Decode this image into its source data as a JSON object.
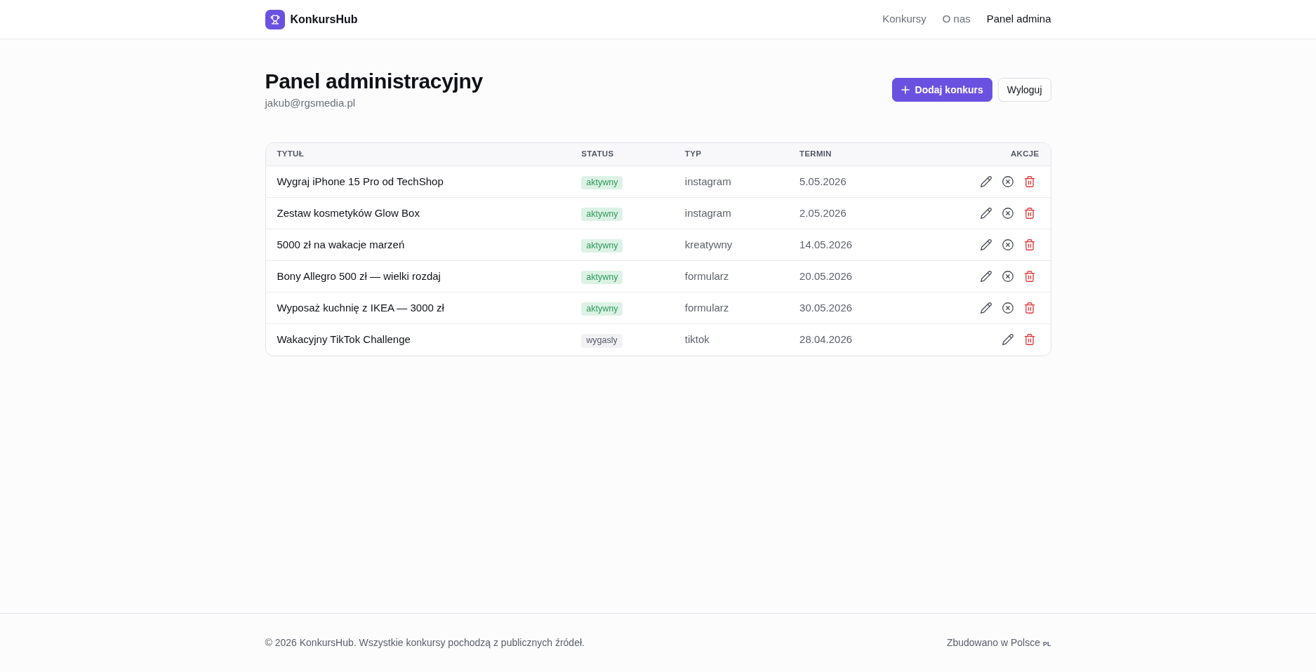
{
  "navbar": {
    "brand": "KonkursHub",
    "links": [
      {
        "label": "Konkursy",
        "selected": false
      },
      {
        "label": "O nas",
        "selected": false
      },
      {
        "label": "Panel admina",
        "selected": true
      }
    ]
  },
  "header": {
    "title": "Panel administracyjny",
    "email": "jakub@rgsmedia.pl",
    "buttons": [
      {
        "label": "Dodaj konkurs",
        "kind": "primary"
      },
      {
        "label": "Wyloguj",
        "kind": "outline"
      }
    ]
  },
  "table": {
    "columns": [
      "TYTUŁ",
      "STATUS",
      "TYP",
      "TERMIN",
      "AKCJE"
    ],
    "rows": [
      {
        "title": "Wygraj iPhone 15 Pro od TechShop",
        "status": "aktywny",
        "active": true,
        "type": "instagram",
        "deadline": "5.05.2026"
      },
      {
        "title": "Zestaw kosmetyków Glow Box",
        "status": "aktywny",
        "active": true,
        "type": "instagram",
        "deadline": "2.05.2026"
      },
      {
        "title": "5000 zł na wakacje marzeń",
        "status": "aktywny",
        "active": true,
        "type": "kreatywny",
        "deadline": "14.05.2026"
      },
      {
        "title": "Bony Allegro 500 zł — wielki rozdaj",
        "status": "aktywny",
        "active": true,
        "type": "formularz",
        "deadline": "20.05.2026"
      },
      {
        "title": "Wyposaż kuchnię z IKEA — 3000 zł",
        "status": "aktywny",
        "active": true,
        "type": "formularz",
        "deadline": "30.05.2026"
      },
      {
        "title": "Wakacyjny TikTok Challenge",
        "status": "wygasly",
        "active": false,
        "type": "tiktok",
        "deadline": "28.04.2026"
      }
    ]
  },
  "footer": {
    "copyright": "© 2026 KonkursHub. Wszystkie konkursy pochodzą z publicznych źródeł.",
    "built": "Zbudowano w Polsce",
    "flag": "PL"
  }
}
